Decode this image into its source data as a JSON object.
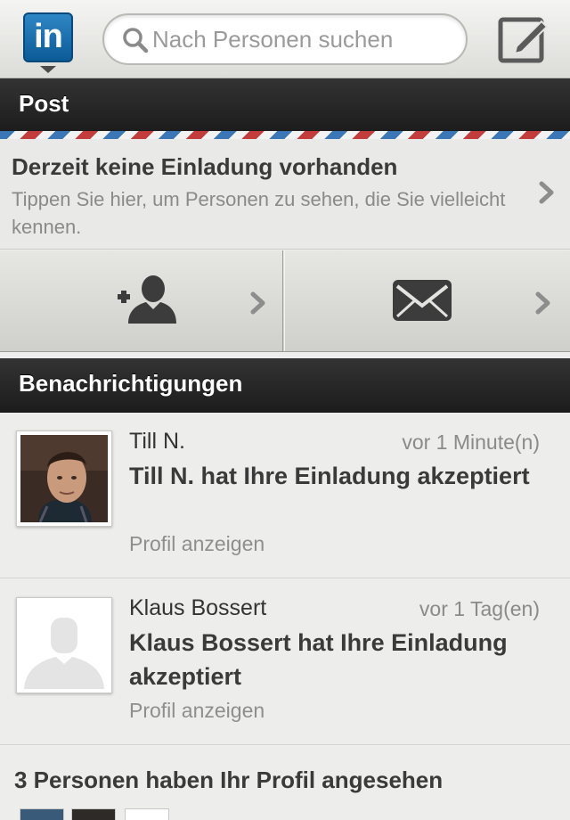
{
  "topbar": {
    "logo_text": "in",
    "search_placeholder": "Nach Personen suchen"
  },
  "post": {
    "header": "Post",
    "invite_title": "Derzeit keine Einladung vorhanden",
    "invite_subtitle": "Tippen Sie hier, um Personen zu sehen, die Sie vielleicht kennen."
  },
  "notifications": {
    "header": "Benachrichtigungen",
    "items": [
      {
        "name": "Till N.",
        "time": "vor 1 Minute(n)",
        "message": "Till N. hat Ihre Einladung akzeptiert",
        "link": "Profil anzeigen"
      },
      {
        "name": "Klaus Bossert",
        "time": "vor 1 Tag(en)",
        "message": "Klaus Bossert hat Ihre Einladung akzeptiert",
        "link": "Profil anzeigen"
      }
    ]
  },
  "viewers": {
    "title": "3 Personen haben Ihr Profil angesehen"
  },
  "colors": {
    "linkedin_blue": "#0b5b97",
    "header_dark": "#222222",
    "airmail_blue": "#3b76b6",
    "airmail_red": "#c43d3d"
  },
  "icons": [
    "search-icon",
    "compose-icon",
    "add-contact-icon",
    "envelope-icon",
    "chevron-right-icon"
  ]
}
